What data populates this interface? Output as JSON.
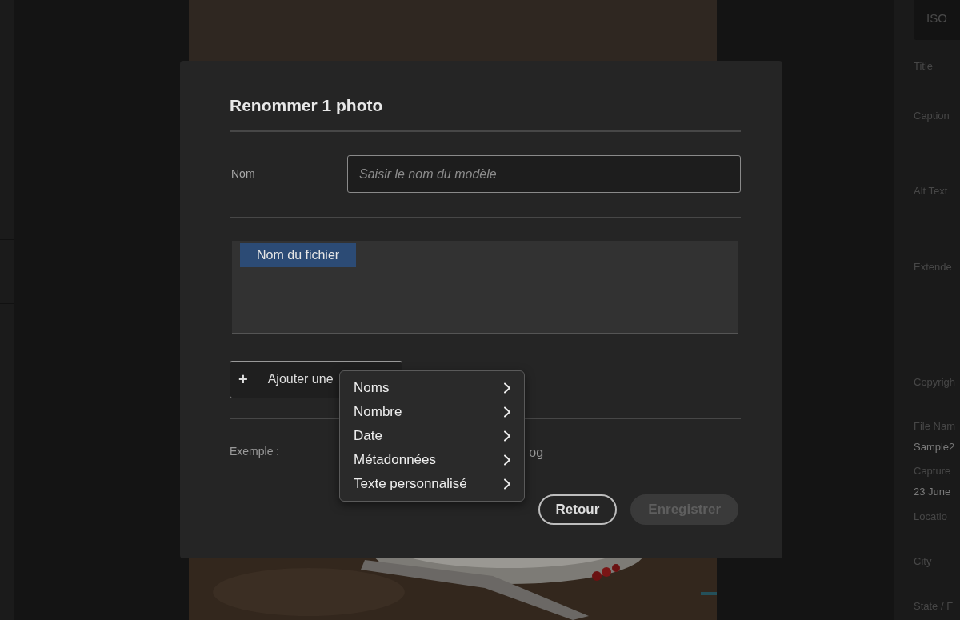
{
  "dialog": {
    "title": "Renommer 1 photo",
    "name_label": "Nom",
    "name_field": {
      "placeholder": "Saisir le nom du modèle"
    },
    "tokens": [
      {
        "label": "Nom du fichier"
      }
    ],
    "add_button": {
      "icon": "+",
      "label": "Ajouter une"
    },
    "example_label": "Exemple :",
    "example_value": "og",
    "buttons": [
      {
        "label": "Retour",
        "disabled": false
      },
      {
        "label": "Enregistrer",
        "disabled": true
      }
    ]
  },
  "menu": [
    {
      "label": "Noms"
    },
    {
      "label": "Nombre"
    },
    {
      "label": "Date"
    },
    {
      "label": "Métadonnées"
    },
    {
      "label": "Texte personnalisé"
    }
  ],
  "metadata_panel": {
    "top_box": "ISO",
    "items": [
      {
        "text": "Title",
        "kind": "label"
      },
      {
        "text": "Caption",
        "kind": "label"
      },
      {
        "text": "Alt Text",
        "kind": "label"
      },
      {
        "text": "Extende",
        "kind": "label"
      },
      {
        "text": "Copyrigh",
        "kind": "label"
      },
      {
        "text": "File Nam",
        "kind": "label"
      },
      {
        "text": "Sample2",
        "kind": "value"
      },
      {
        "text": "Capture",
        "kind": "label"
      },
      {
        "text": "23 June",
        "kind": "value"
      },
      {
        "text": "Locatio",
        "kind": "label"
      },
      {
        "text": "City",
        "kind": "label"
      },
      {
        "text": "State / F",
        "kind": "label"
      }
    ]
  }
}
